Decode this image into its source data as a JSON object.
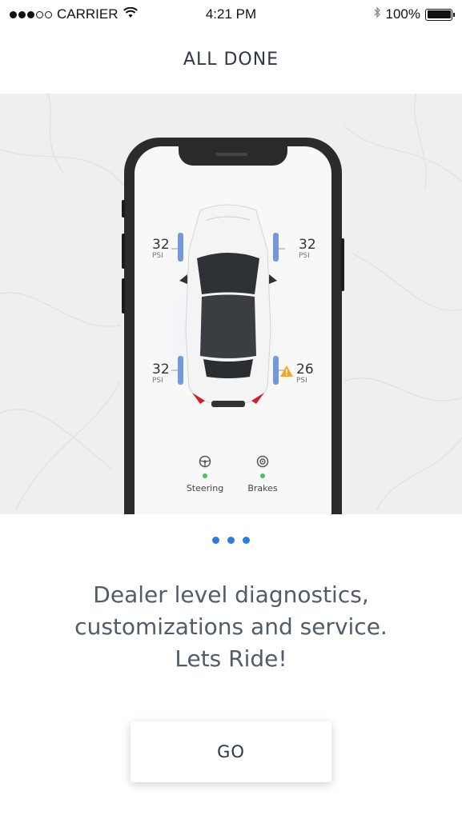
{
  "status_bar": {
    "carrier": "CARRIER",
    "time": "4:21 PM",
    "battery": "100%",
    "icons": [
      "signal-dots",
      "wifi-icon",
      "bluetooth-icon",
      "battery-icon"
    ]
  },
  "header": {
    "title": "ALL DONE"
  },
  "phone_screen": {
    "tires": [
      {
        "position": "front-left",
        "value": "32",
        "unit": "PSI",
        "warning": false
      },
      {
        "position": "front-right",
        "value": "32",
        "unit": "PSI",
        "warning": false
      },
      {
        "position": "rear-left",
        "value": "32",
        "unit": "PSI",
        "warning": false
      },
      {
        "position": "rear-right",
        "value": "26",
        "unit": "PSI",
        "warning": true
      }
    ],
    "systems": [
      {
        "label": "Steering",
        "icon": "steering-wheel-icon",
        "status": "ok"
      },
      {
        "label": "Brakes",
        "icon": "brake-disc-icon",
        "status": "ok"
      }
    ],
    "colors": {
      "ok": "#45c464",
      "warning": "#f5a623",
      "tire_glow": "#4a78d4"
    }
  },
  "pager": {
    "count": 3,
    "color": "#2a7de1"
  },
  "description": {
    "line1": "Dealer level diagnostics,",
    "line2": "customizations and service.",
    "line3": "Lets Ride!"
  },
  "cta": {
    "label": "GO"
  }
}
